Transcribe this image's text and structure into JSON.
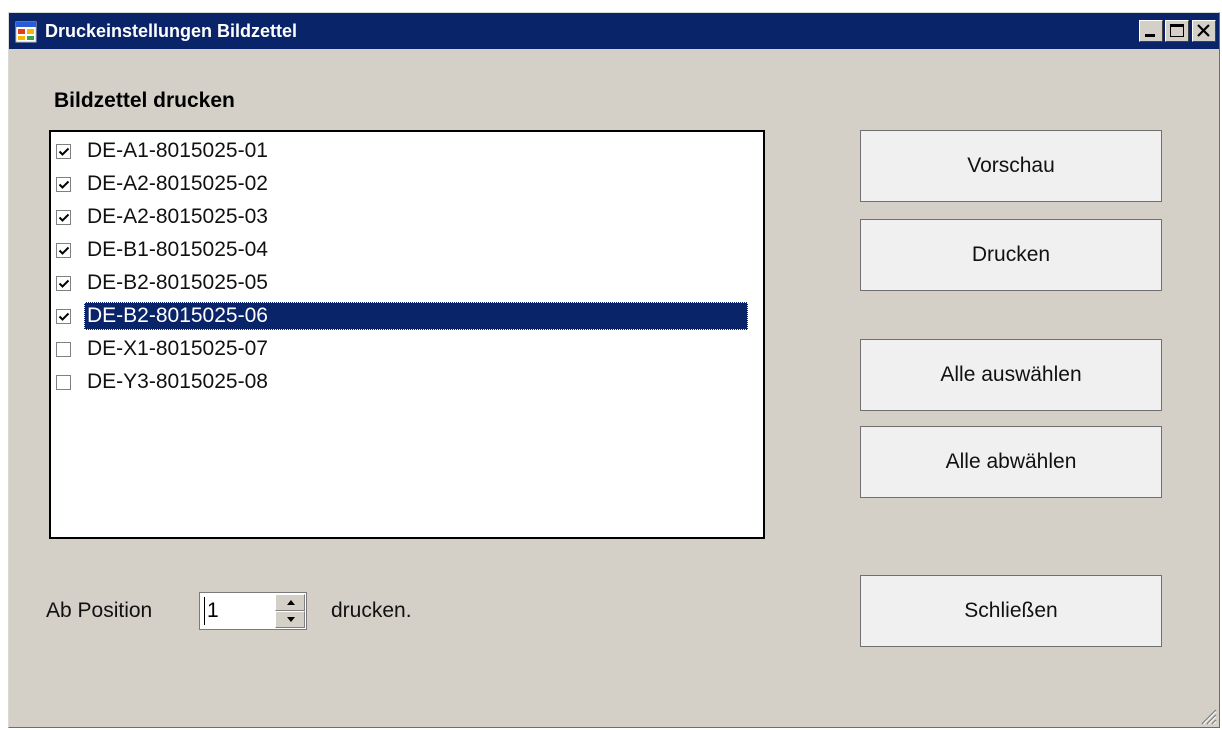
{
  "window": {
    "title": "Druckeinstellungen Bildzettel"
  },
  "colors": {
    "titlebar": "#0a246a",
    "window_bg": "#d4d0c8",
    "selection": "#0a246a"
  },
  "list": {
    "title": "Bildzettel drucken",
    "items": [
      {
        "label": "DE-A1-8015025-01",
        "checked": true,
        "selected": false
      },
      {
        "label": "DE-A2-8015025-02",
        "checked": true,
        "selected": false
      },
      {
        "label": "DE-A2-8015025-03",
        "checked": true,
        "selected": false
      },
      {
        "label": "DE-B1-8015025-04",
        "checked": true,
        "selected": false
      },
      {
        "label": "DE-B2-8015025-05",
        "checked": true,
        "selected": false
      },
      {
        "label": "DE-B2-8015025-06",
        "checked": true,
        "selected": true
      },
      {
        "label": "DE-X1-8015025-07",
        "checked": false,
        "selected": false
      },
      {
        "label": "DE-Y3-8015025-08",
        "checked": false,
        "selected": false
      }
    ]
  },
  "buttons": {
    "preview": "Vorschau",
    "print": "Drucken",
    "select_all": "Alle auswählen",
    "deselect_all": "Alle abwählen",
    "close": "Schließen"
  },
  "position": {
    "prefix": "Ab Position",
    "value": "1",
    "suffix": "drucken."
  },
  "icons": {
    "app": "form-window-icon",
    "minimize": "minimize-icon",
    "maximize": "maximize-icon",
    "close": "close-icon"
  }
}
